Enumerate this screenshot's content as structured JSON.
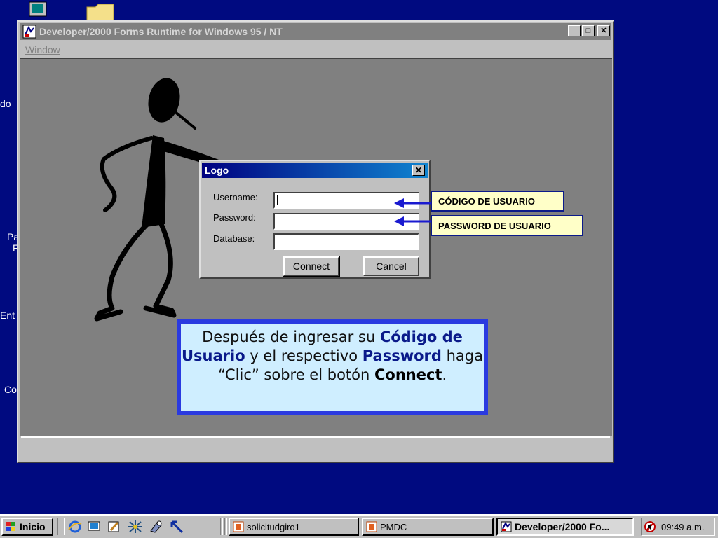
{
  "desktop": {
    "labels": [
      "do",
      "Pa",
      "F",
      "Ent",
      "Co"
    ]
  },
  "window": {
    "title": "Developer/2000 Forms Runtime for Windows 95 / NT",
    "menu": [
      "Window"
    ],
    "buttons": {
      "minimize": "_",
      "maximize": "□",
      "close": "✕"
    }
  },
  "logon_dialog": {
    "title": "Logo",
    "close": "✕",
    "fields": [
      {
        "label": "Username:",
        "value": ""
      },
      {
        "label": "Password:",
        "value": ""
      },
      {
        "label": "Database:",
        "value": ""
      }
    ],
    "connect_label": "Connect",
    "cancel_label": "Cancel"
  },
  "callouts": {
    "username": "CÓDIGO DE USUARIO",
    "password": "PASSWORD DE USUARIO"
  },
  "instruction": {
    "part1": "Después de ingresar su ",
    "part2": "Código de Usuario",
    "part3": " y el respectivo ",
    "part4": "Password",
    "part5": " haga “Clic” sobre el botón ",
    "part6": "Connect",
    "part7": "."
  },
  "taskbar": {
    "start_label": "Inicio",
    "tasks": [
      {
        "label": "solicitudgiro1",
        "icon": "powerpoint-icon"
      },
      {
        "label": "PMDC",
        "icon": "powerpoint-icon"
      },
      {
        "label": "Developer/2000 Fo...",
        "icon": "oracle-forms-icon",
        "active": true
      }
    ],
    "clock": "09:49 a.m."
  },
  "colors": {
    "desktop": "#000a80",
    "dialog_title": "#000080",
    "callout_fill": "#ffffc8",
    "arrow": "#1a1ad0",
    "instruction_fill": "#cfeeff"
  }
}
